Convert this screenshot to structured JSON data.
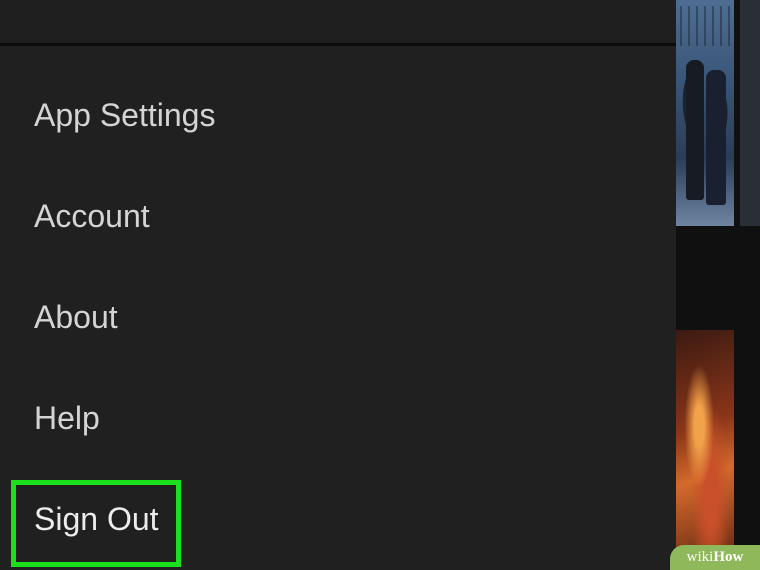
{
  "menu": {
    "items": [
      {
        "label": "App Settings"
      },
      {
        "label": "Account"
      },
      {
        "label": "About"
      },
      {
        "label": "Help"
      },
      {
        "label": "Sign Out",
        "highlighted": true
      }
    ]
  },
  "highlight_color": "#1ce01c",
  "watermark": {
    "part1": "wiki",
    "part2": "How"
  }
}
